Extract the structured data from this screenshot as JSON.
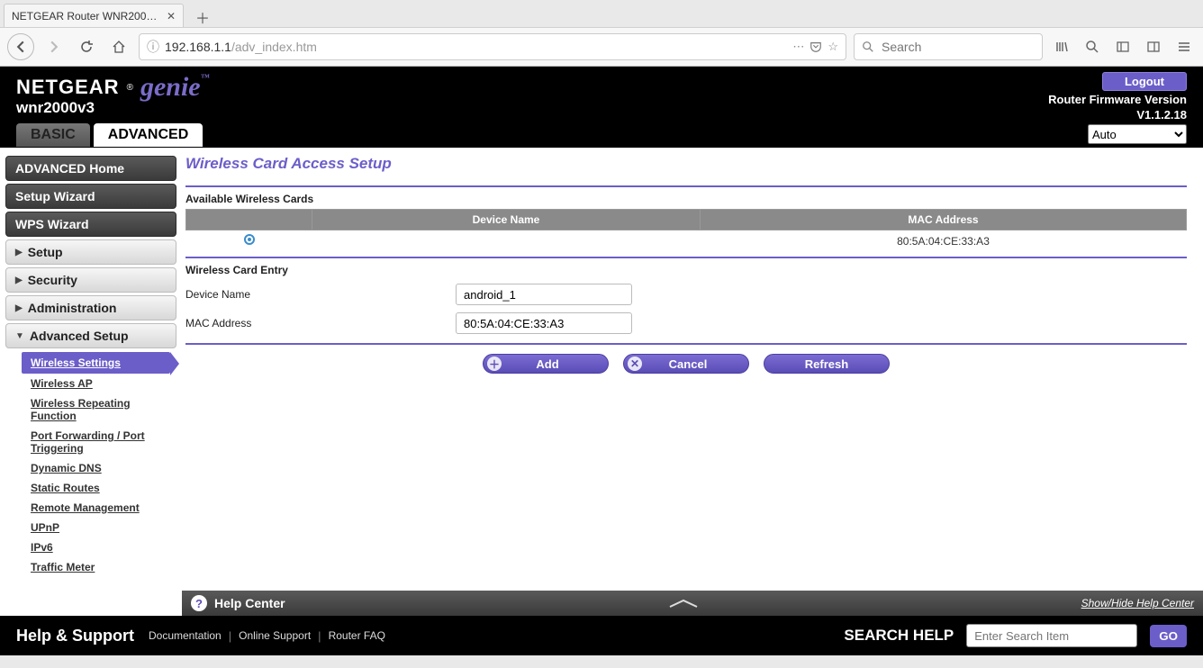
{
  "browser": {
    "tab_title": "NETGEAR Router WNR2000v…",
    "url_host": "192.168.1.1",
    "url_path": "/adv_index.htm",
    "search_placeholder": "Search"
  },
  "header": {
    "brand1": "NETGEAR",
    "brand2": "genie",
    "model": "wnr2000v3",
    "logout": "Logout",
    "fw_label": "Router Firmware Version",
    "fw_version": "V1.1.2.18",
    "tab_basic": "BASIC",
    "tab_advanced": "ADVANCED",
    "lang_selected": "Auto"
  },
  "sidebar": {
    "items": [
      {
        "label": "ADVANCED Home",
        "type": "dark"
      },
      {
        "label": "Setup Wizard",
        "type": "dark"
      },
      {
        "label": "WPS Wizard",
        "type": "dark"
      },
      {
        "label": "Setup",
        "type": "light",
        "caret": "right"
      },
      {
        "label": "Security",
        "type": "light",
        "caret": "right"
      },
      {
        "label": "Administration",
        "type": "light",
        "caret": "right"
      },
      {
        "label": "Advanced Setup",
        "type": "light",
        "caret": "down"
      }
    ],
    "sub": [
      {
        "label": "Wireless Settings",
        "current": true
      },
      {
        "label": "Wireless AP"
      },
      {
        "label": "Wireless Repeating Function"
      },
      {
        "label": "Port Forwarding / Port Triggering"
      },
      {
        "label": "Dynamic DNS"
      },
      {
        "label": "Static Routes"
      },
      {
        "label": "Remote Management"
      },
      {
        "label": "UPnP"
      },
      {
        "label": "IPv6"
      },
      {
        "label": "Traffic Meter"
      }
    ]
  },
  "content": {
    "title": "Wireless Card Access Setup",
    "available_label": "Available Wireless Cards",
    "table": {
      "headers": {
        "sel": "",
        "name": "Device Name",
        "mac": "MAC Address"
      },
      "rows": [
        {
          "selected": true,
          "name": "",
          "mac": "80:5A:04:CE:33:A3"
        }
      ]
    },
    "entry_label": "Wireless Card Entry",
    "entry": {
      "device_name_label": "Device Name",
      "device_name_value": "android_1",
      "mac_label": "MAC Address",
      "mac_value": "80:5A:04:CE:33:A3"
    },
    "buttons": {
      "add": "Add",
      "cancel": "Cancel",
      "refresh": "Refresh"
    },
    "helpbar": {
      "title": "Help Center",
      "toggle": "Show/Hide Help Center"
    }
  },
  "footer": {
    "hs": "Help & Support",
    "links": [
      "Documentation",
      "Online Support",
      "Router FAQ"
    ],
    "search_label": "SEARCH HELP",
    "search_placeholder": "Enter Search Item",
    "go": "GO"
  }
}
